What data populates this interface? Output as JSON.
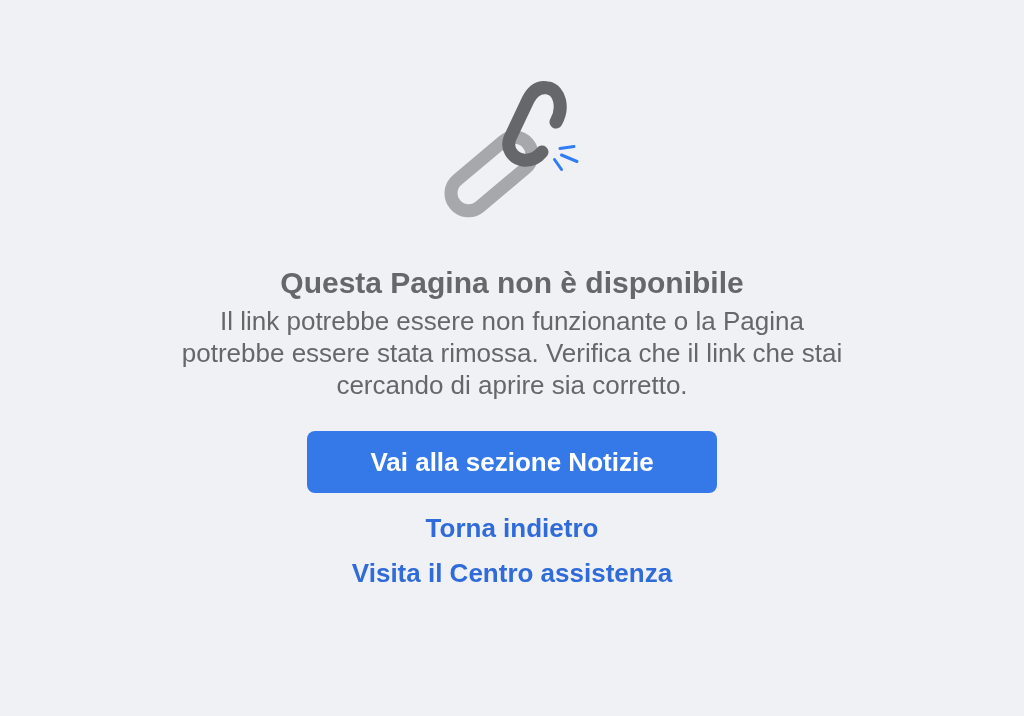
{
  "title": "Questa Pagina non è disponibile",
  "message": "Il link potrebbe essere non funzionante o la Pagina potrebbe essere stata rimossa. Verifica che il link che stai cercando di aprire sia corretto.",
  "primary_button": "Vai alla sezione Notizie",
  "links": [
    "Torna indietro",
    "Visita il Centro assistenza"
  ]
}
